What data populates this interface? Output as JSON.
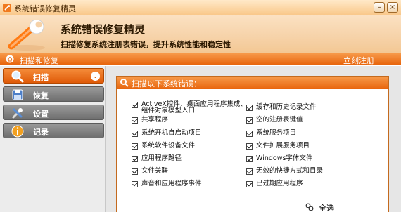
{
  "window": {
    "title": "系统错误修复精灵",
    "minimize_label": "–",
    "close_label": "×"
  },
  "header": {
    "app_title": "系统错误修复精灵",
    "subtitle": "扫描修复系统注册表错误，提升系统性能和稳定性"
  },
  "navbar": {
    "current": "扫描和修复",
    "register": "立刻注册"
  },
  "sidebar": {
    "items": [
      {
        "label": "扫描",
        "icon": "magnifier-icon",
        "active": true
      },
      {
        "label": "恢复",
        "icon": "restore-icon",
        "active": false
      },
      {
        "label": "设置",
        "icon": "settings-icon",
        "active": false
      },
      {
        "label": "记录",
        "icon": "info-icon",
        "active": false
      }
    ],
    "collapse_glyph": "⌄"
  },
  "panel": {
    "title": "扫描以下系统错误：",
    "options_left": [
      {
        "line1": "ActiveX控件、桌面应用程序集成、",
        "line2": "组件对象模型入口",
        "checked": true
      },
      {
        "line1": "共享程序",
        "line2": "",
        "checked": true
      },
      {
        "line1": "系统开机自启动项目",
        "line2": "",
        "checked": true
      },
      {
        "line1": "系统软件设备文件",
        "line2": "",
        "checked": true
      },
      {
        "line1": "应用程序路径",
        "line2": "",
        "checked": true
      },
      {
        "line1": "文件关联",
        "line2": "",
        "checked": true
      },
      {
        "line1": "声音和应用程序事件",
        "line2": "",
        "checked": true
      }
    ],
    "options_right": [
      {
        "line1": "缓存和历史记录文件",
        "line2": "",
        "checked": true
      },
      {
        "line1": "空的注册表键值",
        "line2": "",
        "checked": true
      },
      {
        "line1": "系统服务项目",
        "line2": "",
        "checked": true
      },
      {
        "line1": "文件扩展服务项目",
        "line2": "",
        "checked": true
      },
      {
        "line1": "Windows字体文件",
        "line2": "",
        "checked": true
      },
      {
        "line1": "无效的快捷方式和目录",
        "line2": "",
        "checked": true
      },
      {
        "line1": "已过期应用程序",
        "line2": "",
        "checked": true
      }
    ],
    "select_all": "全选"
  },
  "colors": {
    "accent_orange": "#e8650c",
    "header_bg": "#f6d2a8",
    "sidebar_bg": "#ececec",
    "inactive_item": "#7a7a7a"
  }
}
